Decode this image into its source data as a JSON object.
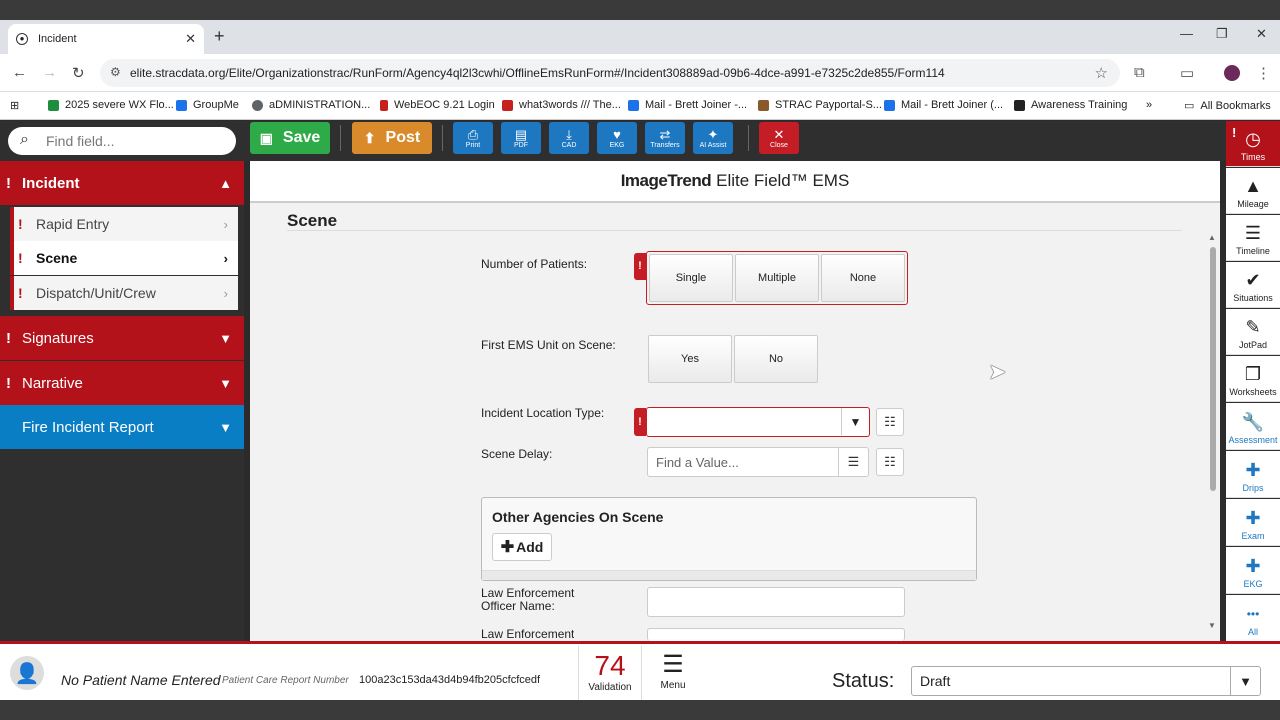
{
  "browser": {
    "tab_title": "Incident",
    "url": "elite.stracdata.org/Elite/Organizationstrac/RunForm/Agency4ql2l3cwhi/OfflineEmsRunForm#/Incident308889ad-09b6-4dce-a991-e7325c2de855/Form114",
    "bookmarks": [
      {
        "label": "2025 severe WX Flo...",
        "color": "#1e8e3e"
      },
      {
        "label": "GroupMe",
        "color": "#1a73e8"
      },
      {
        "label": "aDMINISTRATION...",
        "color": "#5f6368"
      },
      {
        "label": "WebEOC 9.21  Login",
        "color": "#c5221f"
      },
      {
        "label": "what3words /// The...",
        "color": "#c5221f"
      },
      {
        "label": "Mail - Brett Joiner -...",
        "color": "#1a73e8"
      },
      {
        "label": "STRAC Payportal-S...",
        "color": "#8b5a2b"
      },
      {
        "label": "Mail - Brett Joiner (...",
        "color": "#1a73e8"
      },
      {
        "label": "Awareness Training",
        "color": "#222222"
      }
    ],
    "more_bookmarks": "»",
    "all_bookmarks": "All Bookmarks"
  },
  "leftnav": {
    "search_placeholder": "Find field...",
    "sections": [
      {
        "label": "Incident",
        "required": "!",
        "chevron": "⌃"
      },
      {
        "label": "Signatures",
        "required": "!",
        "chevron": "⌄"
      },
      {
        "label": "Narrative",
        "required": "!",
        "chevron": "⌄"
      },
      {
        "label": "Fire Incident Report",
        "chevron": "⌄"
      }
    ],
    "incident_items": [
      {
        "label": "Rapid Entry",
        "required": "!"
      },
      {
        "label": "Scene",
        "required": "!"
      },
      {
        "label": "Dispatch/Unit/Crew",
        "required": "!"
      }
    ]
  },
  "toolbar": {
    "save": "Save",
    "post": "Post",
    "print": "Print",
    "pdf": "PDF",
    "cad": "CAD",
    "ekg": "EKG",
    "transfers": "Transfers",
    "ai_assist": "AI Assist",
    "close": "Close",
    "colors": {
      "save": "#2eaa48",
      "post": "#d98a2b",
      "blue": "#1d78c1",
      "close": "#c51d25"
    }
  },
  "form": {
    "brand_bold": "ImageTrend",
    "brand_rest": "Elite Field™ EMS",
    "title": "Scene",
    "num_patients_label": "Number of Patients:",
    "num_patients_options": [
      "Single",
      "Multiple",
      "None"
    ],
    "first_unit_label": "First EMS Unit on Scene:",
    "first_unit_options": [
      "Yes",
      "No"
    ],
    "location_type_label": "Incident Location Type:",
    "location_type_value": "",
    "scene_delay_label": "Scene Delay:",
    "scene_delay_placeholder": "Find a Value...",
    "other_agencies_title": "Other Agencies On Scene",
    "add_label": "Add",
    "leo_name_label_1": "Law Enforcement",
    "leo_name_label_2": "Officer Name:",
    "leo_next_label": "Law Enforcement",
    "required_flag": "!"
  },
  "rail": [
    {
      "label": "Times",
      "icon": "!",
      "style": "red"
    },
    {
      "label": "Mileage",
      "icon": "▲",
      "style": "dark"
    },
    {
      "label": "Timeline",
      "icon": "☰",
      "style": "dark"
    },
    {
      "label": "Situations",
      "icon": "✔",
      "style": "dark"
    },
    {
      "label": "JotPad",
      "icon": "✎",
      "style": "dark"
    },
    {
      "label": "Worksheets",
      "icon": "❐",
      "style": "dark"
    },
    {
      "label": "Assessment",
      "icon": "🔧",
      "style": "blue"
    },
    {
      "label": "Drips",
      "icon": "✚",
      "style": "blue"
    },
    {
      "label": "Exam",
      "icon": "✚",
      "style": "blue"
    },
    {
      "label": "EKG",
      "icon": "✚",
      "style": "blue"
    },
    {
      "label": "All",
      "icon": "•••",
      "style": "blue"
    }
  ],
  "footer": {
    "patient_name": "No Patient Name Entered",
    "pcr_label": "Patient Care Report Number",
    "pcr_number": "100a23c153da43d4b94fb205cfcfcedf",
    "validation_count": "74",
    "validation_label": "Validation",
    "menu_label": "Menu",
    "status_label": "Status:",
    "status_value": "Draft"
  }
}
